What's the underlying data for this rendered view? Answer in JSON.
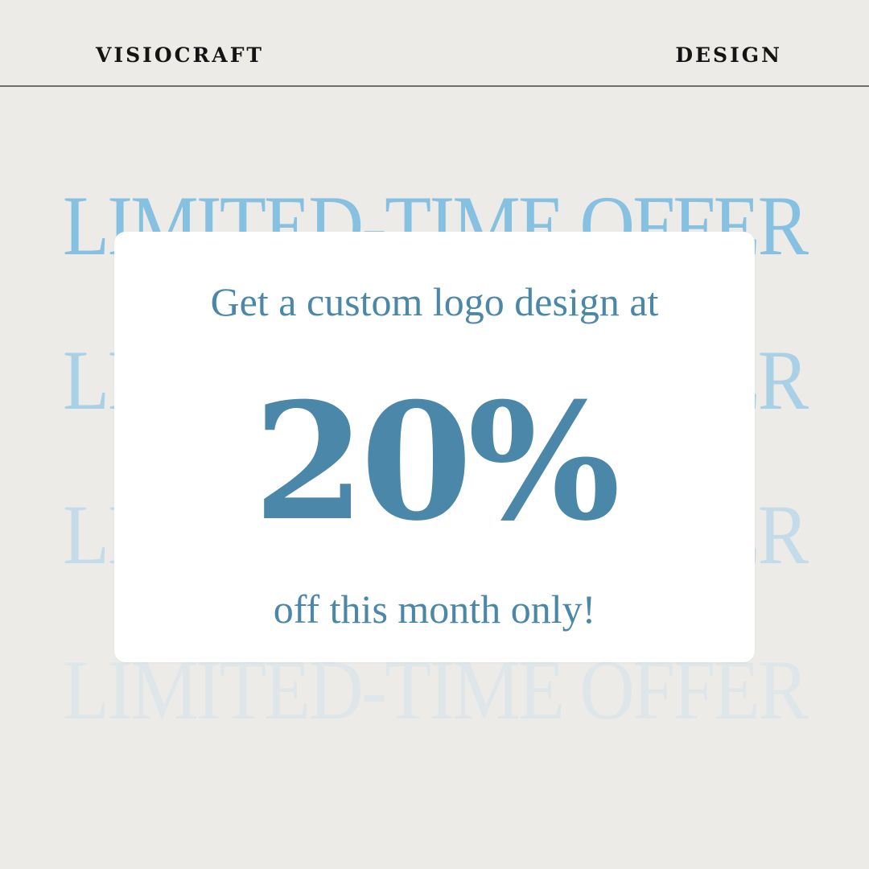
{
  "header": {
    "brand": "VISIOCRAFT",
    "category": "DESIGN"
  },
  "background_text": {
    "repeat_line": "LIMITED-TIME OFFER"
  },
  "offer": {
    "headline": "Get a custom logo design at",
    "discount": "20%",
    "subline": "off this month only!"
  },
  "colors": {
    "background": "#ecebe7",
    "accent": "#4a87a8",
    "card": "#ffffff",
    "text_dark": "#141414"
  }
}
